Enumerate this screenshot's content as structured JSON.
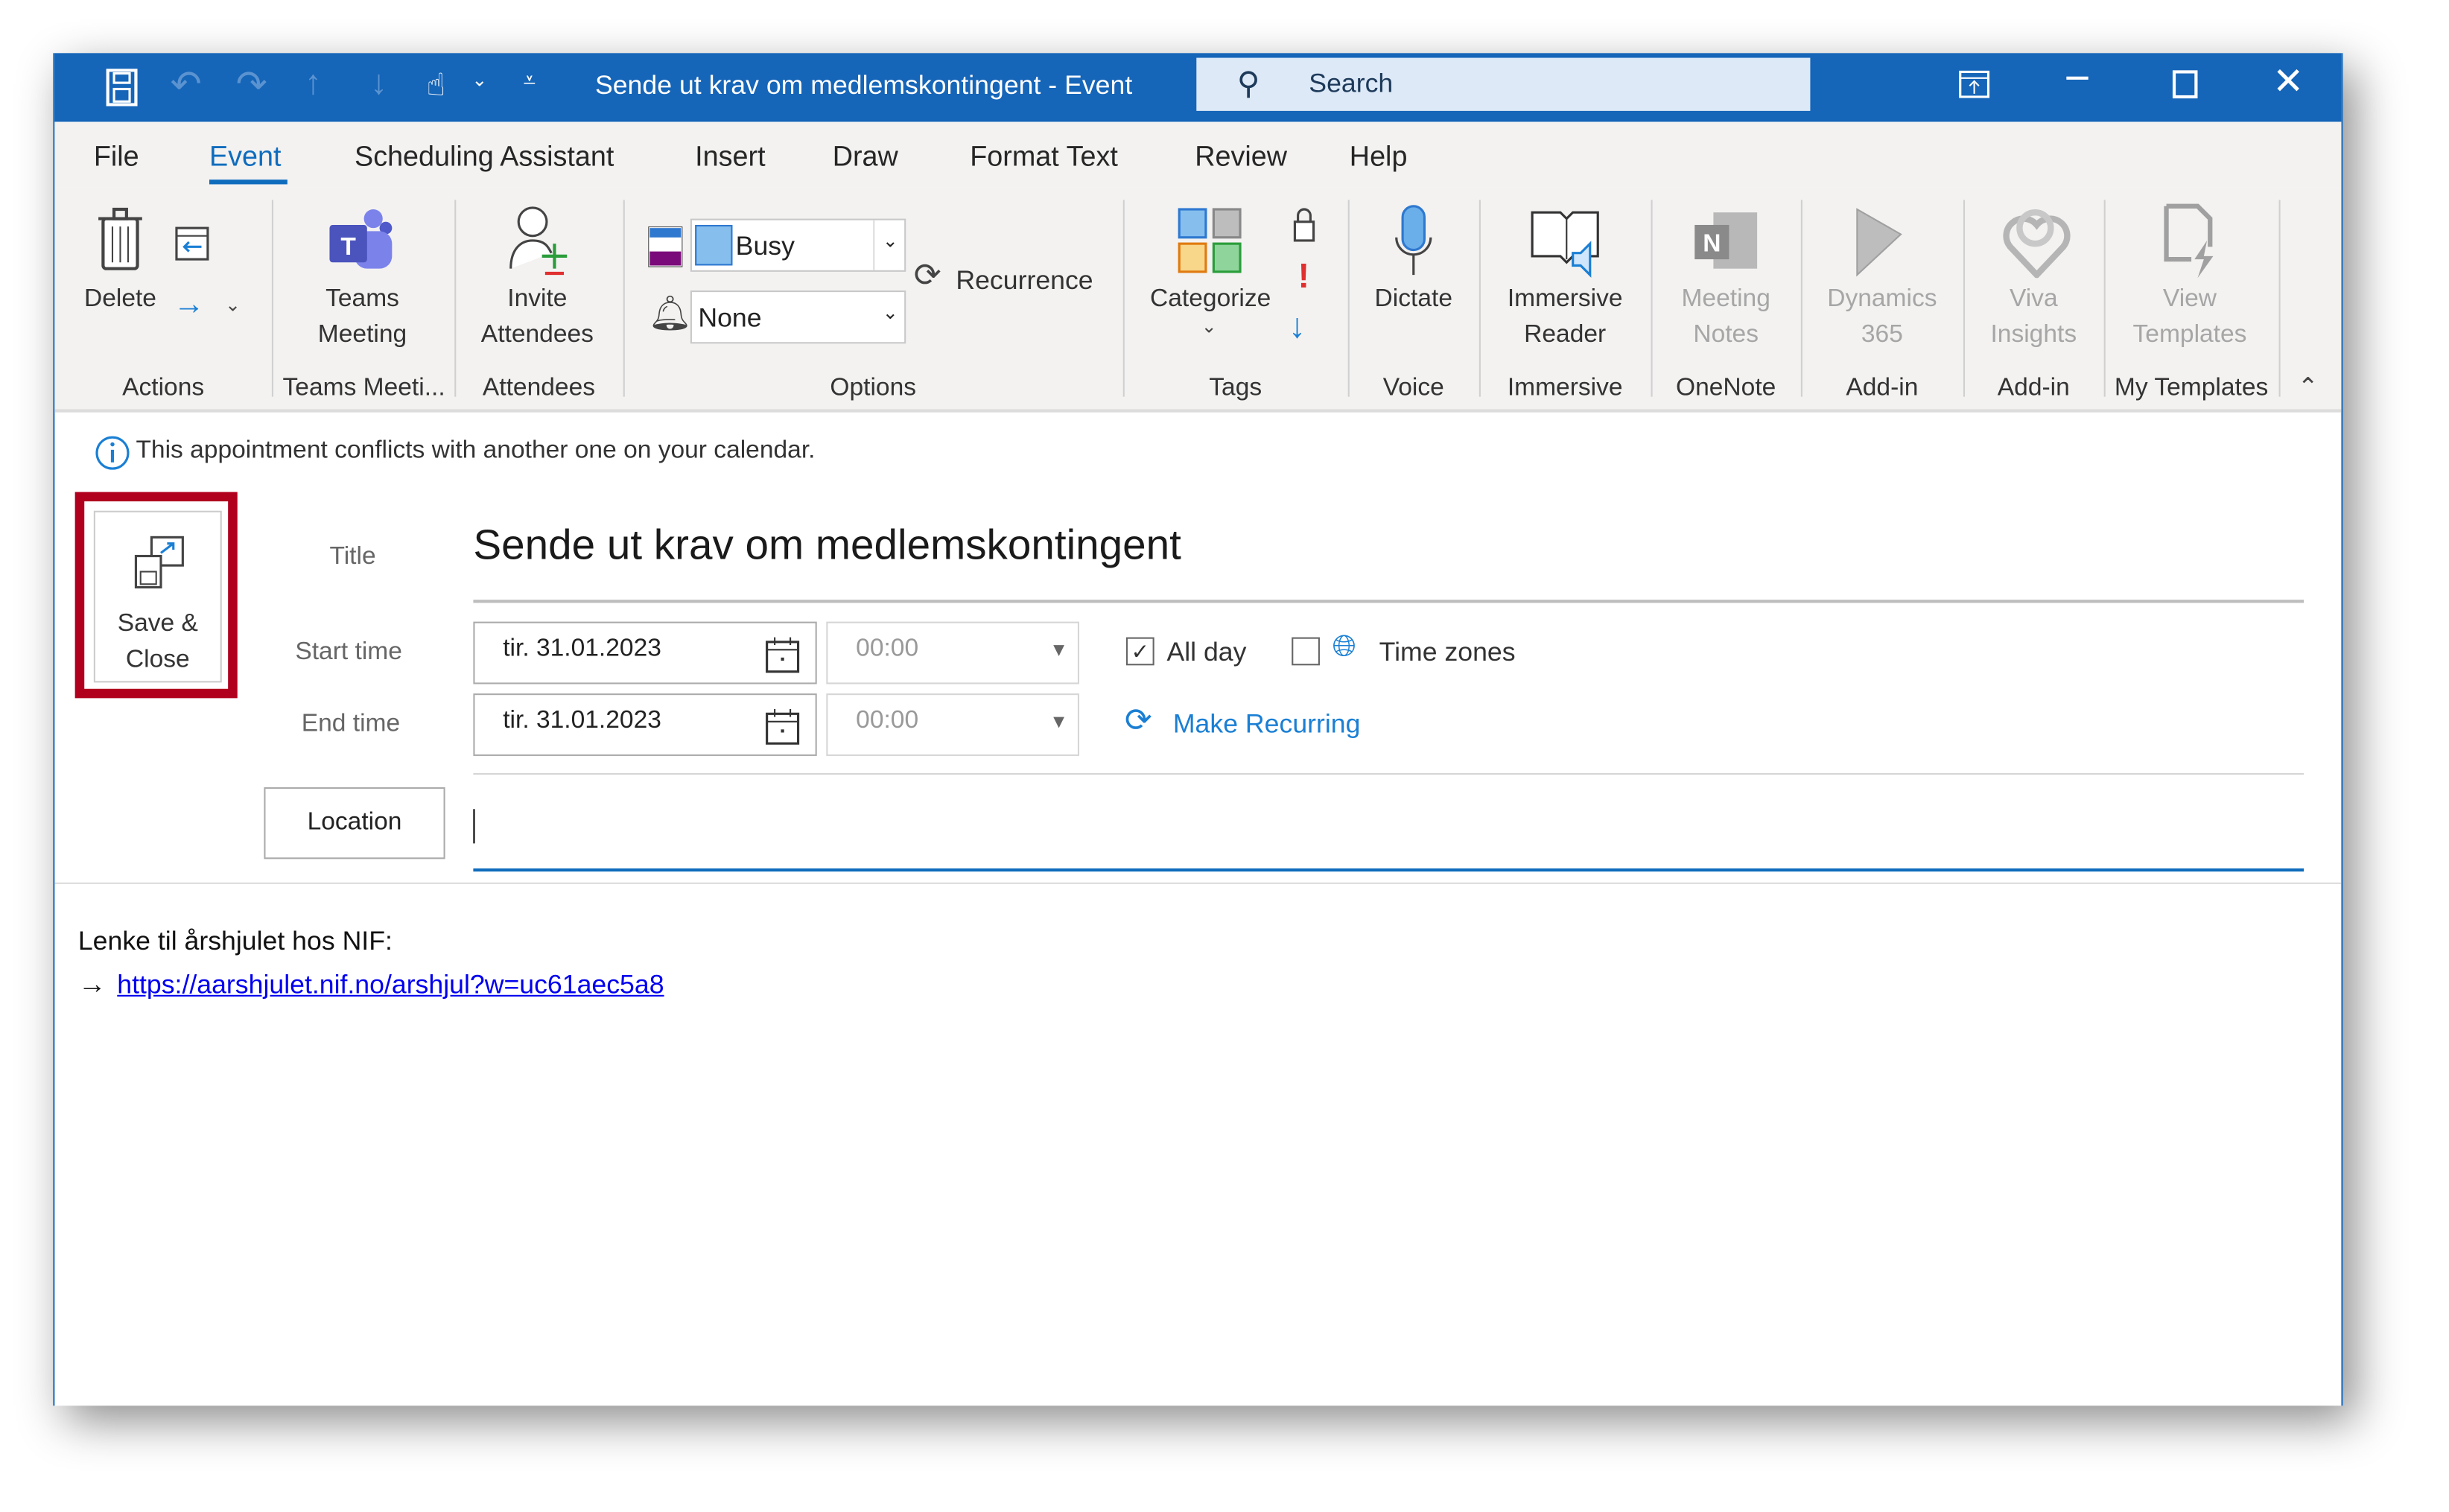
{
  "titlebar": {
    "title": "Sende ut krav om medlemskontingent  -  Event",
    "search_placeholder": "Search"
  },
  "tabs": [
    {
      "label": "File"
    },
    {
      "label": "Event",
      "active": true
    },
    {
      "label": "Scheduling Assistant"
    },
    {
      "label": "Insert"
    },
    {
      "label": "Draw"
    },
    {
      "label": "Format Text"
    },
    {
      "label": "Review"
    },
    {
      "label": "Help"
    }
  ],
  "ribbon": {
    "actions": {
      "delete": "Delete",
      "group": "Actions"
    },
    "teams": {
      "line1": "Teams",
      "line2": "Meeting",
      "group": "Teams Meeti..."
    },
    "attendees": {
      "line1": "Invite",
      "line2": "Attendees",
      "group": "Attendees"
    },
    "options": {
      "show_as": "Busy",
      "reminder": "None",
      "recurrence": "Recurrence",
      "group": "Options"
    },
    "tags": {
      "categorize": "Categorize",
      "group": "Tags"
    },
    "voice": {
      "dictate": "Dictate",
      "group": "Voice"
    },
    "immersive": {
      "line1": "Immersive",
      "line2": "Reader",
      "group": "Immersive"
    },
    "onenote": {
      "line1": "Meeting",
      "line2": "Notes",
      "group": "OneNote"
    },
    "dynamics": {
      "line1": "Dynamics",
      "line2": "365",
      "group": "Add-in"
    },
    "viva": {
      "line1": "Viva",
      "line2": "Insights",
      "group": "Add-in"
    },
    "templates": {
      "line1": "View",
      "line2": "Templates",
      "group": "My Templates"
    }
  },
  "info": {
    "message": "This appointment conflicts with another one on your calendar."
  },
  "form": {
    "save_line1": "Save &",
    "save_line2": "Close",
    "title_label": "Title",
    "title_value": "Sende ut krav om medlemskontingent",
    "start_label": "Start time",
    "start_date": "tir. 31.01.2023",
    "start_time": "00:00",
    "end_label": "End time",
    "end_date": "tir. 31.01.2023",
    "end_time": "00:00",
    "all_day": "All day",
    "all_day_checked": true,
    "time_zones": "Time zones",
    "time_zones_checked": false,
    "make_recurring": "Make Recurring",
    "location_button": "Location",
    "location_value": ""
  },
  "body": {
    "line1": "Lenke til årshjulet hos NIF:",
    "arrow": "→",
    "link": "https://aarshjulet.nif.no/arshjul?w=uc61aec5a8"
  },
  "colors": {
    "titlebar": "#1565b8",
    "accent": "#0f6cbd",
    "highlight_box": "#b0001e",
    "link": "#0000ee"
  }
}
